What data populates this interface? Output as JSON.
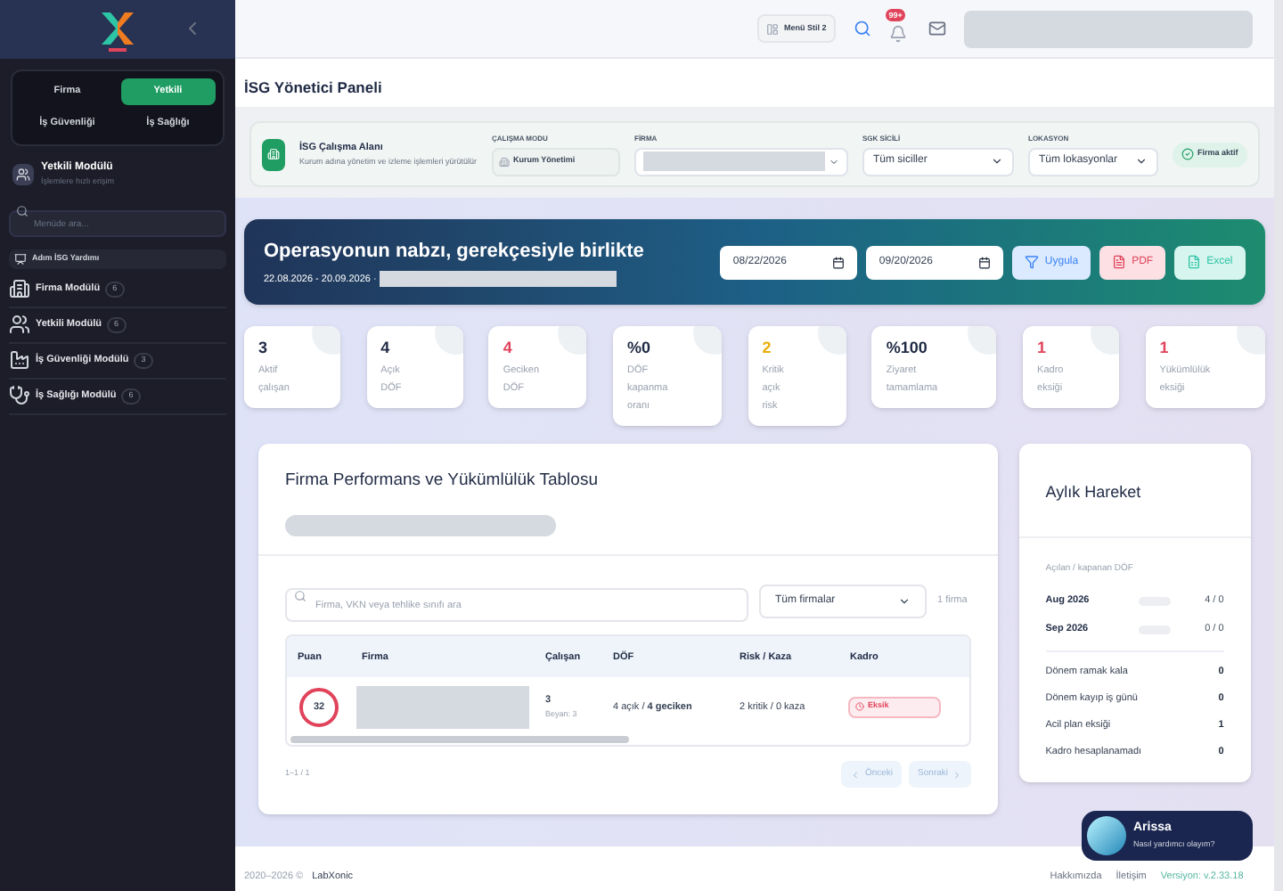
{
  "sidebar": {
    "tabs": [
      {
        "label": "Firma",
        "selected": false
      },
      {
        "label": "Yetkili",
        "selected": true
      },
      {
        "label": "İş Güvenliği",
        "selected": false
      },
      {
        "label": "İş Sağlığı",
        "selected": false
      }
    ],
    "module": {
      "title": "Yetkili Modülü",
      "subtitle": "İşlemlere hızlı erişim"
    },
    "search": {
      "placeholder": "Menüde ara..."
    },
    "helper": "Adım İSG Yardımı",
    "items": [
      {
        "label": "Firma Modülü",
        "count": "6",
        "kind": "building"
      },
      {
        "label": "Yetkili Modülü",
        "count": "6",
        "kind": "users"
      },
      {
        "label": "İş Güvenliği Modülü",
        "count": "3",
        "kind": "factory"
      },
      {
        "label": "İş Sağlığı Modülü",
        "count": "6",
        "kind": "doctor"
      }
    ]
  },
  "header": {
    "menu_style": "Menü Stil 2",
    "notifications": "99+"
  },
  "page_title": "İSG Yönetici Paneli",
  "workspace": {
    "title": "İSG Çalışma Alanı",
    "description": "Kurum adına yönetim ve izleme işlemleri yürütülür",
    "fields": [
      {
        "label": "ÇALIŞMA MODU",
        "kind": "badge",
        "value": "Kurum Yönetimi"
      },
      {
        "label": "FİRMA",
        "kind": "hidden"
      },
      {
        "label": "SGK SİCİLİ",
        "kind": "select",
        "value": "Tüm siciller"
      },
      {
        "label": "LOKASYON",
        "kind": "select",
        "value": "Tüm lokasyonlar"
      }
    ],
    "status": "Firma aktif"
  },
  "hero": {
    "title": "Operasyonun nabzı, gerekçesiyle birlikte",
    "range": "22.08.2026 - 20.09.2026 ·",
    "start": "08/22/2026",
    "end": "09/20/2026",
    "buttons": [
      {
        "label": "Uygula",
        "kind": "filter"
      },
      {
        "label": "PDF",
        "kind": "pdf"
      },
      {
        "label": "Excel",
        "kind": "excel"
      }
    ]
  },
  "kpis": [
    {
      "value": "3",
      "label": "Aktif çalışan",
      "color": "#1f2a44"
    },
    {
      "value": "4",
      "label": "Açık DÖF",
      "color": "#1f2a44"
    },
    {
      "value": "4",
      "label": "Geciken DÖF",
      "color": "#e0435a"
    },
    {
      "value": "%0",
      "label": "DÖF kapanma oranı",
      "color": "#1f2a44"
    },
    {
      "value": "2",
      "label": "Kritik açık risk",
      "color": "#e8b00c"
    },
    {
      "value": "%100",
      "label": "Ziyaret tamamlama",
      "color": "#1f2a44"
    },
    {
      "value": "1",
      "label": "Kadro eksiği",
      "color": "#e0435a"
    },
    {
      "value": "1",
      "label": "Yükümlülük eksiği",
      "color": "#e0435a"
    }
  ],
  "table_card": {
    "title": "Firma Performans ve Yükümlülük Tablosu",
    "search": {
      "placeholder": "Firma, VKN veya tehlike sınıfı ara"
    },
    "filter": "Tüm firmalar",
    "count": "1 firma",
    "columns": [
      "Puan",
      "Firma",
      "Çalışan",
      "DÖF",
      "Risk / Kaza",
      "Kadro"
    ],
    "rows": [
      {
        "score": "32",
        "employees": "3",
        "declared": "Beyan: 3",
        "dof": "4 açık / **4 geciken**",
        "risk": "2 kritik / 0 kaza",
        "staff": "Eksik"
      }
    ],
    "range": "1–1 / 1",
    "prev": "Önceki",
    "next": "Sonraki"
  },
  "monthly": {
    "title": "Aylık Hareket",
    "subtitle": "Açılan / kapanan DÖF",
    "months": [
      {
        "label": "Aug 2026",
        "value": "4 / 0"
      },
      {
        "label": "Sep 2026",
        "value": "0 / 0"
      }
    ],
    "stats": [
      {
        "label": "Dönem ramak kala",
        "value": "0"
      },
      {
        "label": "Dönem kayıp iş günü",
        "value": "0"
      },
      {
        "label": "Acil plan eksiği",
        "value": "1"
      },
      {
        "label": "Kadro hesaplanamadı",
        "value": "0"
      }
    ]
  },
  "footer": {
    "copyright": "2020–2026 ©",
    "brand": "LabXonic",
    "links": [
      "Hakkımızda",
      "İletişim"
    ],
    "version": "Versiyon: v.2.33.18"
  },
  "chat": {
    "name": "Arissa",
    "prompt": "Nasıl yardımcı olayım?"
  }
}
